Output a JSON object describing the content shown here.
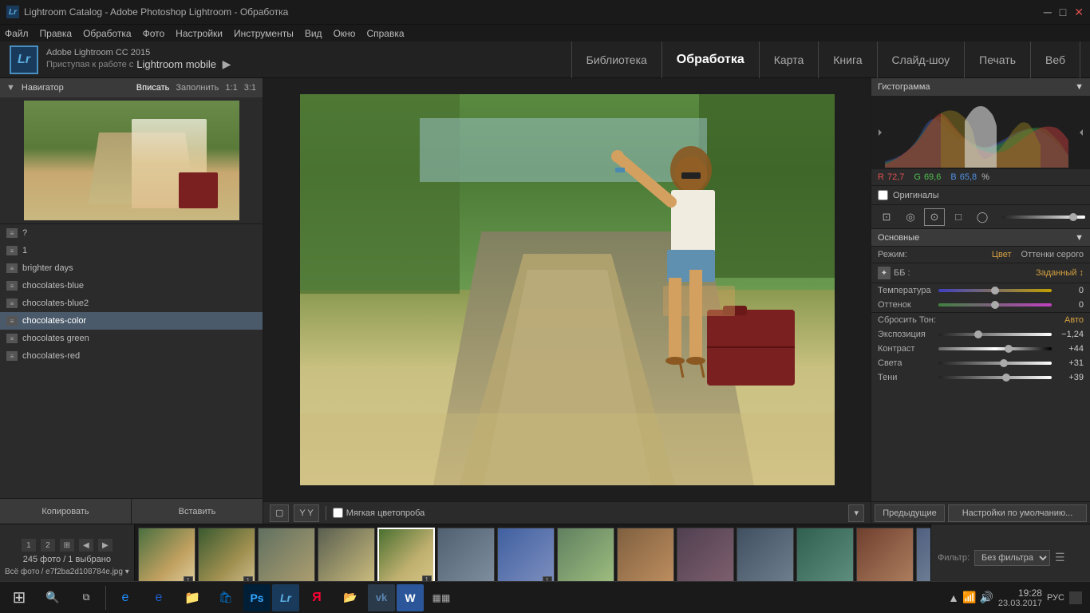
{
  "titlebar": {
    "title": "Lightroom Catalog - Adobe Photoshop Lightroom - Обработка",
    "icon": "Lr"
  },
  "menubar": {
    "items": [
      "Файл",
      "Правка",
      "Обработка",
      "Фото",
      "Настройки",
      "Инструменты",
      "Вид",
      "Окно",
      "Справка"
    ]
  },
  "topnav": {
    "logo": "Lr",
    "brand": "Adobe Lightroom CC 2015",
    "subtitle": "Приступая к работе с",
    "mobile_text": "Lightroom mobile",
    "nav_items": [
      "Библиотека",
      "Обработка",
      "Карта",
      "Книга",
      "Слайд-шоу",
      "Печать",
      "Веб"
    ],
    "active_nav": "Обработка"
  },
  "left_panel": {
    "navigator_title": "Навигатор",
    "nav_controls": [
      "Вписать",
      "Заполнить",
      "1:1",
      "3:1"
    ],
    "active_nav_control": "Вписать",
    "presets": [
      {
        "id": "q",
        "label": "?"
      },
      {
        "id": "1",
        "label": "1"
      },
      {
        "id": "brighter_days",
        "label": "brighter days"
      },
      {
        "id": "choc_blue",
        "label": "chocolates-blue"
      },
      {
        "id": "choc_blue2",
        "label": "chocolates-blue2"
      },
      {
        "id": "choc_color",
        "label": "chocolates-color"
      },
      {
        "id": "choc_green",
        "label": "chocolates green"
      },
      {
        "id": "choc_red",
        "label": "chocolates-red"
      }
    ],
    "selected_preset": "choc_color",
    "copy_btn": "Копировать",
    "paste_btn": "Вставить"
  },
  "center": {
    "toolbar_btns": [
      "▢",
      "Y Y"
    ],
    "softproof_label": "Мягкая цветопроба",
    "filmstrip_count": "245 фото / 1 выбрано",
    "filmstrip_path": "e7f2ba2d108784e.jpg",
    "all_photos": "Всё фото",
    "filter_label": "Фильтр:",
    "filter_value": "Без фильтра"
  },
  "right_panel": {
    "histogram_title": "Гистограмма",
    "r_value": "72,7",
    "g_value": "69,6",
    "b_value": "65,8",
    "r_label": "R",
    "g_label": "G",
    "b_label": "B",
    "percent": "%",
    "originals_label": "Оригиналы",
    "basic_title": "Основные",
    "mode_label": "Режим:",
    "mode_value": "Цвет",
    "mode_value2": "Оттенки серого",
    "wb_label": "ББ :",
    "wb_value": "Заданный",
    "wb_arrow": "↕",
    "temp_label": "Температура",
    "temp_value": "0",
    "tint_label": "Оттенок",
    "tint_value": "0",
    "reset_tone_label": "Сбросить Тон:",
    "reset_tone_btn": "Авто",
    "exposure_label": "Экспозиция",
    "exposure_value": "−1,24",
    "contrast_label": "Контраст",
    "contrast_value": "+44",
    "highlights_label": "Света",
    "highlights_value": "+31",
    "shadows_label": "Тени",
    "shadows_value": "+39",
    "prev_btn": "Предыдущие",
    "default_btn": "Настройки по умолчанию..."
  },
  "filmstrip": {
    "view_btns": [
      "1",
      "2"
    ],
    "grid_btn": "⊞",
    "nav_btns": [
      "◀",
      "▶"
    ],
    "filmstrip_count": "245 фото / 1 выбрано",
    "path": "/ e7f2ba2d108784e.jpg ▾"
  },
  "taskbar": {
    "time": "19:28",
    "date": "23.03.2017",
    "lang": "РУС"
  }
}
